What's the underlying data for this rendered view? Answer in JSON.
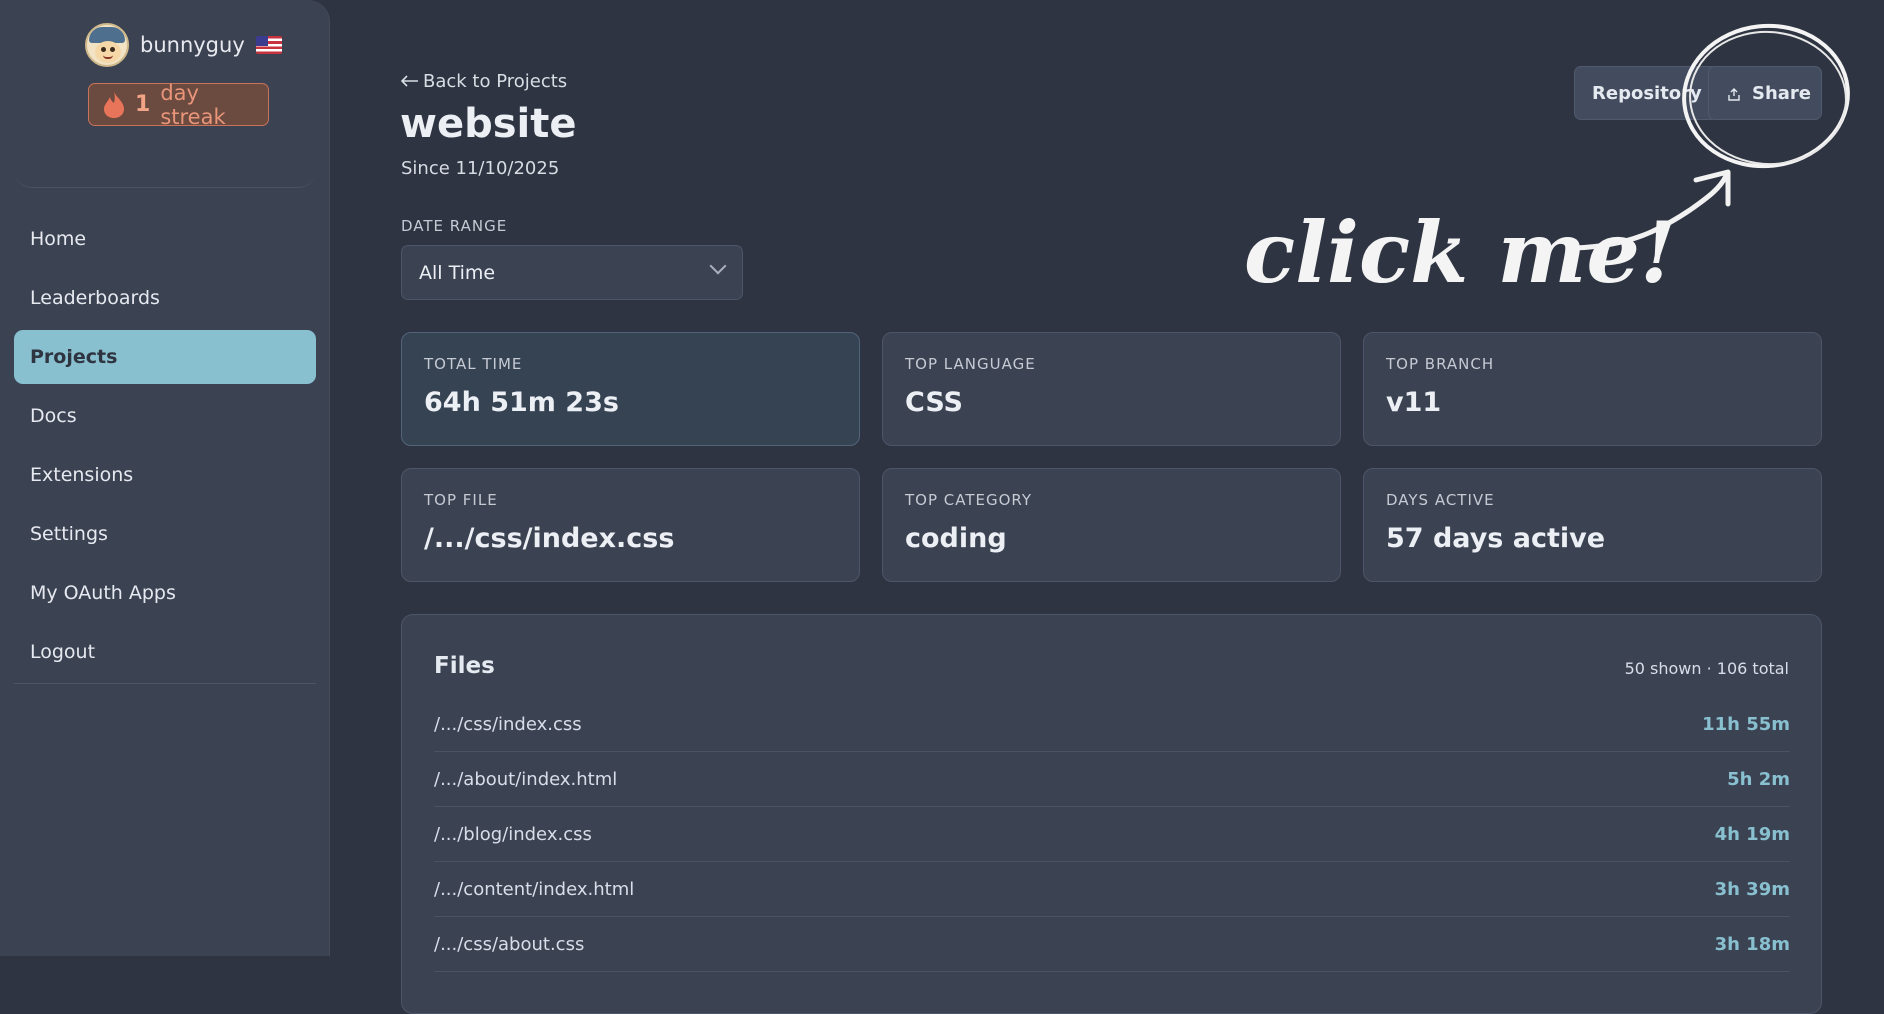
{
  "sidebar": {
    "username": "bunnyguy",
    "flag_icon": "us-flag-icon",
    "streak": {
      "count": "1",
      "label": "day streak"
    },
    "nav": [
      {
        "label": "Home"
      },
      {
        "label": "Leaderboards"
      },
      {
        "label": "Projects",
        "active": true
      },
      {
        "label": "Docs"
      },
      {
        "label": "Extensions"
      },
      {
        "label": "Settings"
      },
      {
        "label": "My OAuth Apps"
      },
      {
        "label": "Logout"
      }
    ]
  },
  "header": {
    "back_label": "Back to Projects",
    "title": "website",
    "since": "Since 11/10/2025",
    "range_label": "DATE RANGE",
    "range_value": "All Time",
    "repository_label": "Repository",
    "share_label": "Share",
    "annotation_text": "click me!"
  },
  "stats": [
    {
      "label": "TOTAL TIME",
      "value": "64h 51m 23s"
    },
    {
      "label": "TOP LANGUAGE",
      "value": "CSS"
    },
    {
      "label": "TOP BRANCH",
      "value": "v11"
    },
    {
      "label": "TOP FILE",
      "value": "/.../css/index.css"
    },
    {
      "label": "TOP CATEGORY",
      "value": "coding"
    },
    {
      "label": "DAYS ACTIVE",
      "value": "57 days active"
    }
  ],
  "files": {
    "title": "Files",
    "count": "50 shown · 106 total",
    "rows": [
      {
        "name": "/.../css/index.css",
        "time": "11h 55m"
      },
      {
        "name": "/.../about/index.html",
        "time": "5h 2m"
      },
      {
        "name": "/.../blog/index.css",
        "time": "4h 19m"
      },
      {
        "name": "/.../content/index.html",
        "time": "3h 39m"
      },
      {
        "name": "/.../css/about.css",
        "time": "3h 18m"
      }
    ]
  },
  "colors": {
    "background": "#2e3441",
    "sidebar": "#3b4252",
    "accent": "#88c0d0",
    "streak": "#f0a184"
  }
}
